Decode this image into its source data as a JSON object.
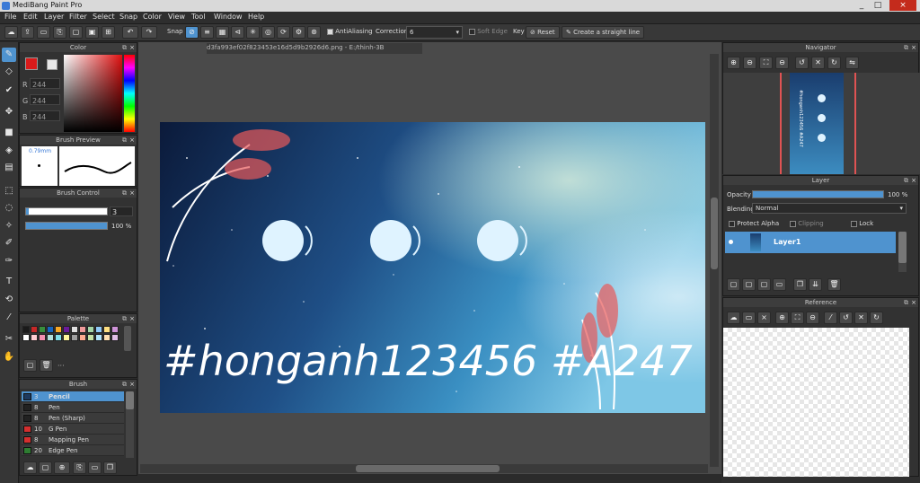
{
  "window": {
    "title": "MediBang Paint Pro",
    "min": "_",
    "max": "□",
    "close": "×"
  },
  "menu": [
    "File",
    "Edit",
    "Layer",
    "Filter",
    "Select",
    "Snap",
    "Color",
    "View",
    "Tool",
    "Window",
    "Help"
  ],
  "toolbar": {
    "snap_label": "Snap",
    "antialias_label": "AntiAliasing",
    "correction_label": "Correction",
    "correction_value": "6",
    "soft_edge_label": "Soft Edge",
    "key_label": "Key",
    "reset_label": "Reset",
    "straight_line_label": "Create a straight line"
  },
  "document": {
    "tab": "d3fa993ef02f823453e16d5d9b2926d6.png - E:/thinh-3B"
  },
  "color_panel": {
    "title": "Color",
    "r_label": "R",
    "r": "244",
    "g_label": "G",
    "g": "244",
    "b_label": "B",
    "b": "244",
    "fg": "#d91a1a",
    "bg": "#ffffff"
  },
  "brush_preview": {
    "title": "Brush Preview",
    "size": "0.79mm"
  },
  "brush_control": {
    "title": "Brush Control",
    "size_value": "3",
    "opacity_value": "100 %"
  },
  "palette": {
    "title": "Palette",
    "colors": [
      "#1a1a1a",
      "#c62828",
      "#388e3c",
      "#1565c0",
      "#f9a825",
      "#6a1b9a",
      "#e0e0e0",
      "#ef9a9a",
      "#a5d6a7",
      "#90caf9",
      "#ffe082",
      "#ce93d8",
      "#ffffff",
      "#ffcdd2",
      "#f48fb1",
      "#b2dfdb",
      "#80deea",
      "#fff59d",
      "#9e9e9e",
      "#ffab91",
      "#c5e1a5",
      "#b3e5fc",
      "#ffe0b2",
      "#e1bee7"
    ],
    "more": "···"
  },
  "brush_panel": {
    "title": "Brush",
    "items": [
      {
        "size": "3",
        "name": "Pencil",
        "color": "#1e3a5f",
        "selected": true
      },
      {
        "size": "8",
        "name": "Pen",
        "color": "#222222",
        "selected": false
      },
      {
        "size": "8",
        "name": "Pen (Sharp)",
        "color": "#222222",
        "selected": false
      },
      {
        "size": "10",
        "name": "G Pen",
        "color": "#d32f2f",
        "selected": false
      },
      {
        "size": "8",
        "name": "Mapping Pen",
        "color": "#d32f2f",
        "selected": false
      },
      {
        "size": "20",
        "name": "Edge Pen",
        "color": "#2e7d32",
        "selected": false
      }
    ]
  },
  "artwork": {
    "handwriting": "#honganh123456 #A247"
  },
  "navigator": {
    "title": "Navigator",
    "thumb_text": "#honganh123456 #A247"
  },
  "layer_panel": {
    "title": "Layer",
    "opacity_label": "Opacity",
    "opacity_value": "100 %",
    "blending_label": "Blending",
    "blending_value": "Normal",
    "protect_alpha_label": "Protect Alpha",
    "clipping_label": "Clipping",
    "lock_label": "Lock",
    "layers": [
      {
        "name": "Layer1"
      }
    ]
  },
  "reference": {
    "title": "Reference"
  },
  "colors": {
    "accent": "#4f93cf",
    "panel": "#323232",
    "canvas_bg": "#4a4a4a"
  }
}
